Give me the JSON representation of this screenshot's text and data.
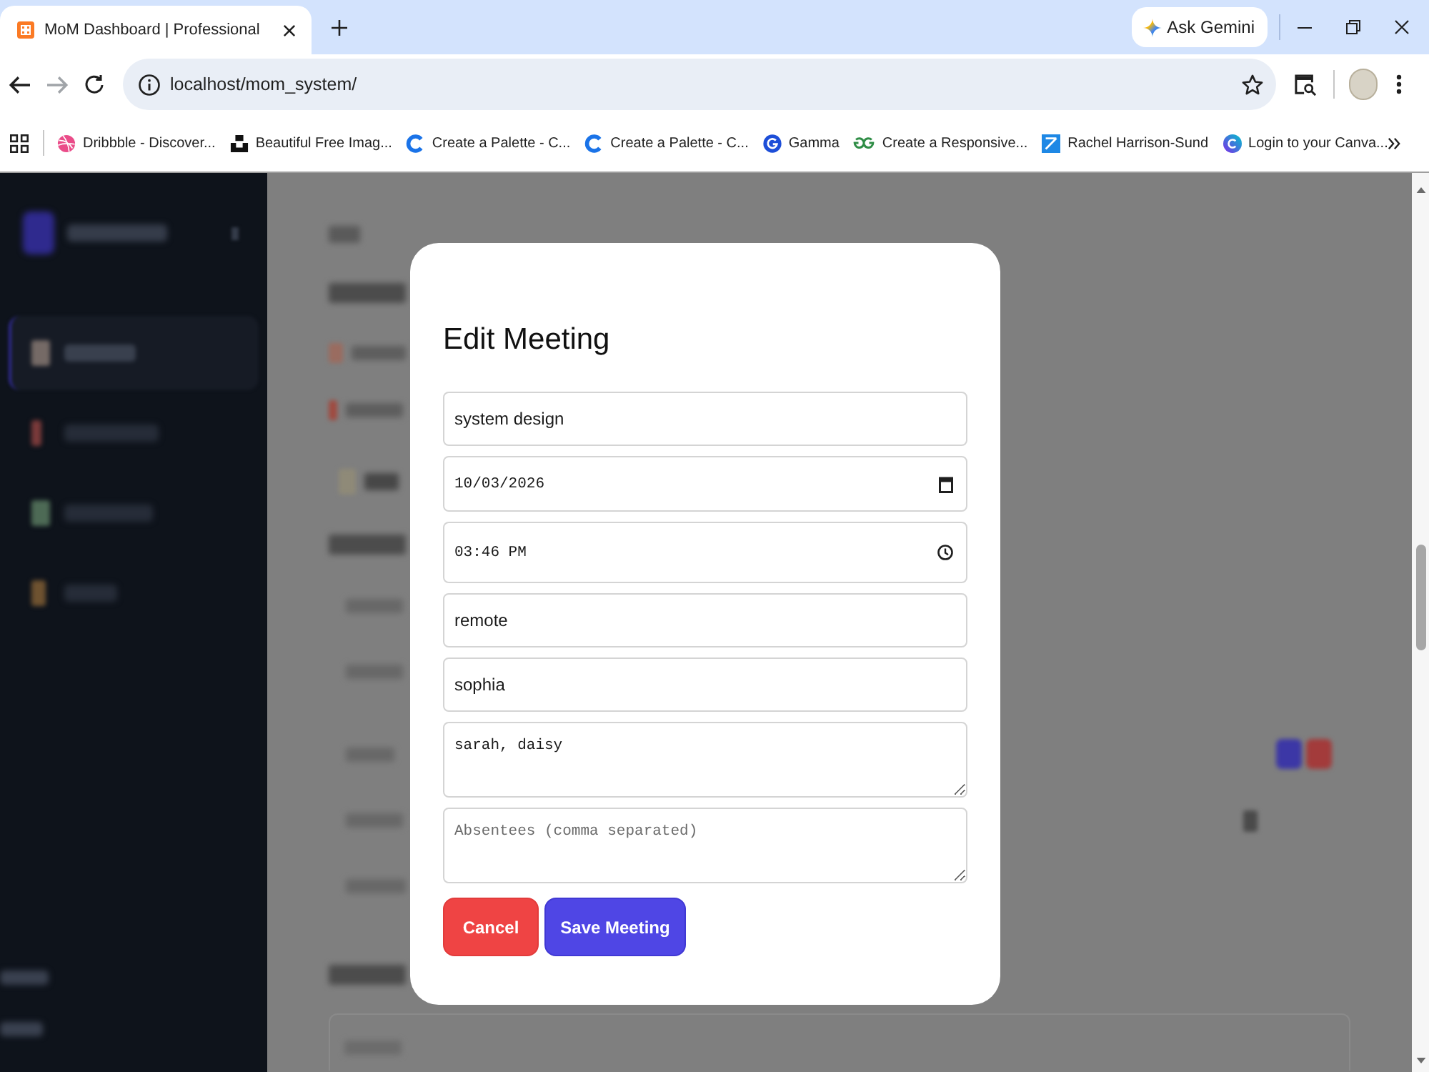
{
  "browser": {
    "tabs": [
      {
        "title": "MoM Dashboard | Professional",
        "selected": true
      }
    ],
    "ask_gemini": "Ask Gemini",
    "address": "localhost/mom_system/",
    "bookmarks": [
      "Dribbble - Discover...",
      "Beautiful Free Imag...",
      "Create a Palette - C...",
      "Create a Palette - C...",
      "Gamma",
      "Create a Responsive...",
      "Rachel Harrison-Sund",
      "Login to your Canva..."
    ]
  },
  "dialog": {
    "title": "Edit Meeting",
    "fields": [
      {
        "kind": "text",
        "value": "system design"
      },
      {
        "kind": "date",
        "value": "10/03/2026"
      },
      {
        "kind": "time",
        "value": "03:46 PM"
      },
      {
        "kind": "text",
        "value": "remote"
      },
      {
        "kind": "text",
        "value": "sophia"
      },
      {
        "kind": "textarea",
        "value": "sarah, daisy"
      },
      {
        "kind": "textarea",
        "placeholder": "Absentees (comma separated)"
      }
    ],
    "buttons": [
      {
        "kind": "cancel",
        "label": "Cancel"
      },
      {
        "kind": "primary",
        "label": "Save Meeting"
      }
    ]
  }
}
